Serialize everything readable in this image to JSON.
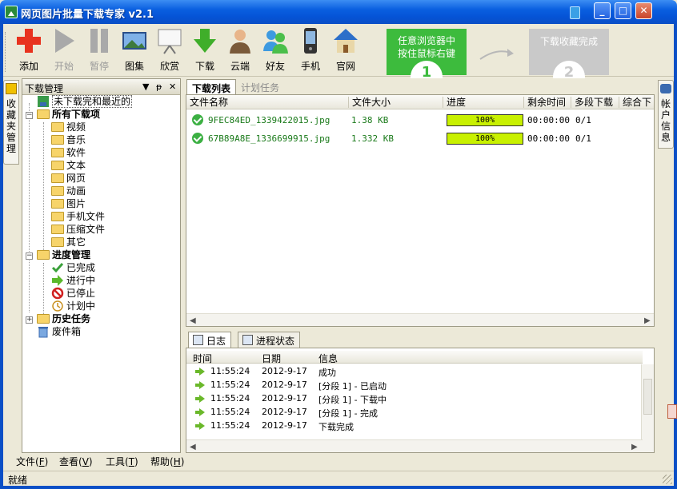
{
  "window": {
    "title": "网页图片批量下载专家 v2.1",
    "controls": {
      "minimize": "_",
      "maximize": "□",
      "close": "✕"
    }
  },
  "toolbar": {
    "items": [
      {
        "label": "添加",
        "icon": "plus-icon",
        "enabled": true
      },
      {
        "label": "开始",
        "icon": "play-icon",
        "enabled": false
      },
      {
        "label": "暂停",
        "icon": "pause-icon",
        "enabled": false
      },
      {
        "label": "图集",
        "icon": "gallery-icon",
        "enabled": true
      },
      {
        "label": "欣赏",
        "icon": "presentation-board-icon",
        "enabled": true
      },
      {
        "label": "下载",
        "icon": "download-arrow-icon",
        "enabled": true
      },
      {
        "label": "云端",
        "icon": "person-icon",
        "enabled": true
      },
      {
        "label": "好友",
        "icon": "friends-icon",
        "enabled": true
      },
      {
        "label": "手机",
        "icon": "phone-icon",
        "enabled": true
      },
      {
        "label": "官网",
        "icon": "house-icon",
        "enabled": true
      }
    ],
    "promo_step1": {
      "line1": "任意浏览器中",
      "line2": "按住鼠标右键",
      "number": "1"
    },
    "promo_step2": {
      "text": "下载收藏完成",
      "number": "2"
    }
  },
  "side_tabs": {
    "left": "收藏夹管理",
    "right": "帐户信息"
  },
  "left_panel": {
    "title": "下载管理",
    "controls": {
      "dropdown": "▼",
      "pin": "ᵽ",
      "close": "✕"
    },
    "tree": {
      "recent": "未下载完和最近的",
      "all_downloads": "所有下载项",
      "categories": [
        "视频",
        "音乐",
        "软件",
        "文本",
        "网页",
        "动画",
        "图片",
        "手机文件",
        "压缩文件",
        "其它"
      ],
      "progress": "进度管理",
      "progress_items": [
        "已完成",
        "进行中",
        "已停止",
        "计划中"
      ],
      "history": "历史任务",
      "trash": "废件箱"
    }
  },
  "main_tabs": {
    "download_list": "下载列表",
    "scheduled": "计划任务"
  },
  "download_table": {
    "headers": [
      "文件名称",
      "文件大小",
      "进度",
      "剩余时间",
      "多段下载",
      "综合下"
    ],
    "rows": [
      {
        "name": "9FEC84ED_1339422015.jpg",
        "size": "1.38 KB",
        "progress": "100%",
        "progress_value": 100,
        "remaining": "00:00:00",
        "segments": "0/1"
      },
      {
        "name": "67B89A8E_1336699915.jpg",
        "size": "1.332 KB",
        "progress": "100%",
        "progress_value": 100,
        "remaining": "00:00:00",
        "segments": "0/1"
      }
    ]
  },
  "bottom_tabs": {
    "log": "日志",
    "process_status": "进程状态"
  },
  "log_table": {
    "headers": [
      "时间",
      "日期",
      "信息"
    ],
    "rows": [
      {
        "time": "11:55:24",
        "date": "2012-9-17",
        "info": "成功"
      },
      {
        "time": "11:55:24",
        "date": "2012-9-17",
        "info": "[分段 1] - 已启动"
      },
      {
        "time": "11:55:24",
        "date": "2012-9-17",
        "info": "[分段 1] - 下载中"
      },
      {
        "time": "11:55:24",
        "date": "2012-9-17",
        "info": "[分段 1] - 完成"
      },
      {
        "time": "11:55:24",
        "date": "2012-9-17",
        "info": "下载完成"
      }
    ]
  },
  "menu": {
    "file": "文件",
    "file_key": "F",
    "view": "查看",
    "view_key": "V",
    "tools": "工具",
    "tools_key": "T",
    "help": "帮助",
    "help_key": "H"
  },
  "status": {
    "text": "就绪"
  },
  "colors": {
    "titlebar": "#0553d6",
    "progress_fill": "#c8f000",
    "promo_green": "#3dbb3d",
    "promo_gray": "#c9c9c9"
  }
}
